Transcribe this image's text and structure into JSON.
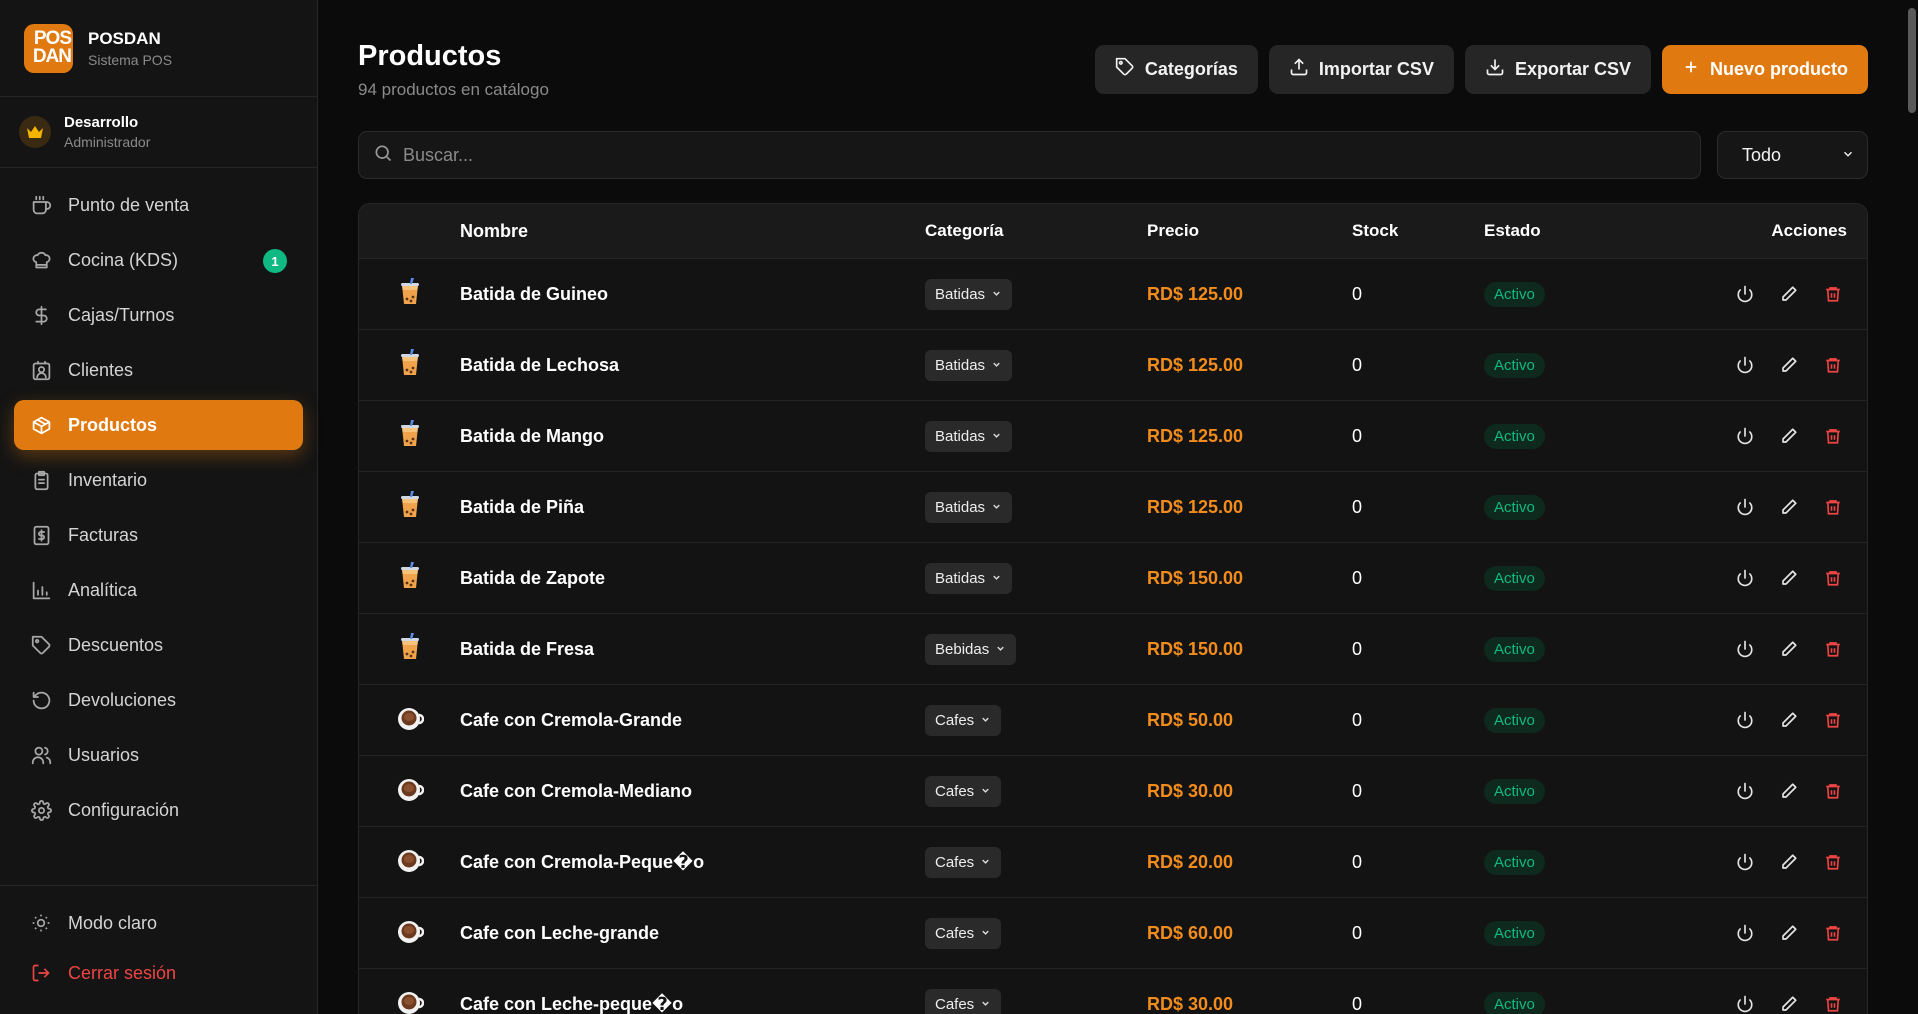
{
  "brand": {
    "logo_line1": "POS",
    "logo_line2": "DAN",
    "name": "POSDAN",
    "subtitle": "Sistema POS"
  },
  "user": {
    "name": "Desarrollo",
    "role": "Administrador"
  },
  "nav": [
    {
      "label": "Punto de venta",
      "icon": "coffee-cup-icon"
    },
    {
      "label": "Cocina (KDS)",
      "icon": "chef-hat-icon",
      "badge": "1"
    },
    {
      "label": "Cajas/Turnos",
      "icon": "dollar-icon"
    },
    {
      "label": "Clientes",
      "icon": "contact-icon"
    },
    {
      "label": "Productos",
      "icon": "box-icon",
      "active": true
    },
    {
      "label": "Inventario",
      "icon": "clipboard-icon"
    },
    {
      "label": "Facturas",
      "icon": "invoice-icon"
    },
    {
      "label": "Analítica",
      "icon": "bar-chart-icon"
    },
    {
      "label": "Descuentos",
      "icon": "tag-icon"
    },
    {
      "label": "Devoluciones",
      "icon": "rotate-icon"
    },
    {
      "label": "Usuarios",
      "icon": "users-icon"
    },
    {
      "label": "Configuración",
      "icon": "gear-icon"
    }
  ],
  "bottom_nav": {
    "theme_label": "Modo claro",
    "logout_label": "Cerrar sesión"
  },
  "page": {
    "title": "Productos",
    "subtitle": "94 productos en catálogo"
  },
  "actions": {
    "categories": "Categorías",
    "import": "Importar CSV",
    "export": "Exportar CSV",
    "new": "Nuevo producto"
  },
  "search": {
    "placeholder": "Buscar..."
  },
  "filter": {
    "selected": "Todo"
  },
  "table": {
    "headers": {
      "name": "Nombre",
      "category": "Categoría",
      "price": "Precio",
      "stock": "Stock",
      "state": "Estado",
      "actions": "Acciones"
    },
    "rows": [
      {
        "name": "Batida de Guineo",
        "category": "Batidas",
        "price": "RD$ 125.00",
        "stock": "0",
        "state": "Activo",
        "img": "bubble-tea-icon"
      },
      {
        "name": "Batida de Lechosa",
        "category": "Batidas",
        "price": "RD$ 125.00",
        "stock": "0",
        "state": "Activo",
        "img": "bubble-tea-icon"
      },
      {
        "name": "Batida de Mango",
        "category": "Batidas",
        "price": "RD$ 125.00",
        "stock": "0",
        "state": "Activo",
        "img": "bubble-tea-icon"
      },
      {
        "name": "Batida de Piña",
        "category": "Batidas",
        "price": "RD$ 125.00",
        "stock": "0",
        "state": "Activo",
        "img": "bubble-tea-icon"
      },
      {
        "name": "Batida de Zapote",
        "category": "Batidas",
        "price": "RD$ 150.00",
        "stock": "0",
        "state": "Activo",
        "img": "bubble-tea-icon"
      },
      {
        "name": "Batida de Fresa",
        "category": "Bebidas",
        "price": "RD$ 150.00",
        "stock": "0",
        "state": "Activo",
        "img": "bubble-tea-icon"
      },
      {
        "name": "Cafe con Cremola-Grande",
        "category": "Cafes",
        "price": "RD$ 50.00",
        "stock": "0",
        "state": "Activo",
        "img": "coffee-mug-icon"
      },
      {
        "name": "Cafe con Cremola-Mediano",
        "category": "Cafes",
        "price": "RD$ 30.00",
        "stock": "0",
        "state": "Activo",
        "img": "coffee-mug-icon"
      },
      {
        "name": "Cafe con Cremola-Peque�o",
        "category": "Cafes",
        "price": "RD$ 20.00",
        "stock": "0",
        "state": "Activo",
        "img": "coffee-mug-icon"
      },
      {
        "name": "Cafe con Leche-grande",
        "category": "Cafes",
        "price": "RD$ 60.00",
        "stock": "0",
        "state": "Activo",
        "img": "coffee-mug-icon"
      },
      {
        "name": "Cafe con Leche-peque�o",
        "category": "Cafes",
        "price": "RD$ 30.00",
        "stock": "0",
        "state": "Activo",
        "img": "coffee-mug-icon"
      }
    ]
  },
  "colors": {
    "accent": "#e07a10",
    "price": "#f28c1c",
    "success": "#10b981",
    "danger": "#ef4444"
  }
}
